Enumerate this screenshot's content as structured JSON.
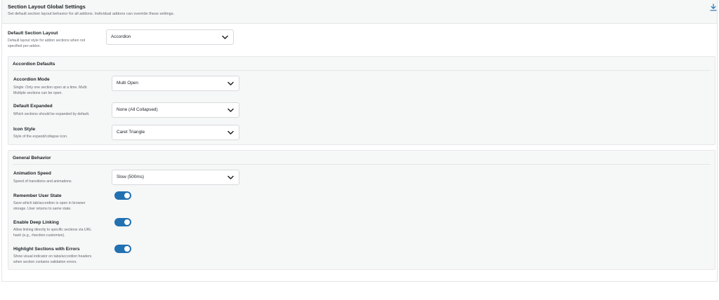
{
  "header": {
    "title": "Section Layout Global Settings",
    "description": "Set default section layout behavior for all addons. Individual addons can override these settings.",
    "download_icon": "download-icon"
  },
  "default_layout": {
    "label": "Default Section Layout",
    "description_line1": "Default layout style for addon sections when not",
    "description_line2": "specified per-addon.",
    "value": "Accordion"
  },
  "accordion_defaults": {
    "title": "Accordion Defaults",
    "mode": {
      "label": "Accordion Mode",
      "description_line1": "Single: Only one section open at a time. Multi:",
      "description_line2": "Multiple sections can be open.",
      "value": "Multi Open"
    },
    "expanded": {
      "label": "Default Expanded",
      "description_line1": "Which sections should be expanded by default.",
      "value": "None (All Collapsed)"
    },
    "icon_style": {
      "label": "Icon Style",
      "description_line1": "Style of the expand/collapse icon.",
      "value": "Caret Triangle"
    }
  },
  "general_behavior": {
    "title": "General Behavior",
    "animation_speed": {
      "label": "Animation Speed",
      "description_line1": "Speed of transitions and animations.",
      "value": "Slow (500ms)"
    },
    "remember_state": {
      "label": "Remember User State",
      "description_line1": "Save which tab/accordion is open in browser",
      "description_line2": "storage. User returns to same state.",
      "enabled": true
    },
    "deep_linking": {
      "label": "Enable Deep Linking",
      "description_line1": "Allow linking directly to specific sections via URL",
      "description_line2": "hash (e.g., #section-customize).",
      "enabled": true
    },
    "highlight_errors": {
      "label": "Highlight Sections with Errors",
      "description_line1": "Show visual indicator on tabs/accordion headers",
      "description_line2": "when section contains validation errors.",
      "enabled": true
    }
  },
  "colors": {
    "accent": "#2271b1",
    "group_background": "#f6f7f7",
    "border": "#e3e5e8"
  }
}
